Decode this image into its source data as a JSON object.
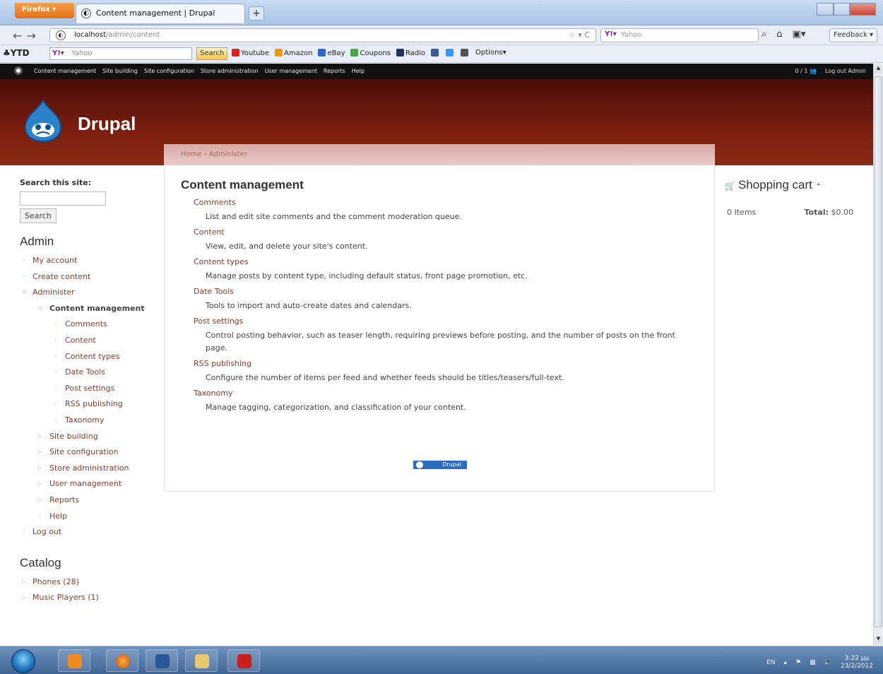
{
  "browser": {
    "button_label": "Firefox",
    "tab_title": "Content management | Drupal",
    "url_host": "localhost",
    "url_path": "/admin/content",
    "search_engine": "Yahoo",
    "feedback_label": "Feedback"
  },
  "toolbar": {
    "brand": "YTD",
    "search_placeholder": "Yahoo",
    "search_button": "Search",
    "links": [
      "Youtube",
      "Amazon",
      "eBay",
      "Coupons",
      "Radio",
      "Options"
    ]
  },
  "admin_menu": {
    "items": [
      "Content management",
      "Site building",
      "Site configuration",
      "Store administration",
      "User management",
      "Reports",
      "Help"
    ],
    "users_count": "0 / 1",
    "logout": "Log out Admin"
  },
  "site": {
    "name": "Drupal",
    "breadcrumb": "Home › Administer"
  },
  "search_block": {
    "title": "Search this site:",
    "button": "Search"
  },
  "admin_block": {
    "title": "Admin",
    "items": [
      "My account",
      "Create content",
      "Administer",
      "Content management",
      "Comments",
      "Content",
      "Content types",
      "Date Tools",
      "Post settings",
      "RSS publishing",
      "Taxonomy",
      "Site building",
      "Site configuration",
      "Store administration",
      "User management",
      "Reports",
      "Help",
      "Log out"
    ]
  },
  "catalog": {
    "title": "Catalog",
    "items": [
      "Phones (28)",
      "Music Players (1)"
    ]
  },
  "main": {
    "title": "Content management",
    "entries": [
      {
        "title": "Comments",
        "desc": "List and edit site comments and the comment moderation queue."
      },
      {
        "title": "Content",
        "desc": "View, edit, and delete your site's content."
      },
      {
        "title": "Content types",
        "desc": "Manage posts by content type, including default status, front page promotion, etc."
      },
      {
        "title": "Date Tools",
        "desc": "Tools to import and auto-create dates and calendars."
      },
      {
        "title": "Post settings",
        "desc": "Control posting behavior, such as teaser length, requiring previews before posting, and the number of posts on the front page."
      },
      {
        "title": "RSS publishing",
        "desc": "Configure the number of items per feed and whether feeds should be titles/teasers/full-text."
      },
      {
        "title": "Taxonomy",
        "desc": "Manage tagging, categorization, and classification of your content."
      }
    ],
    "powered_by": "Drupal"
  },
  "cart": {
    "title": "Shopping cart",
    "items": "0 Items",
    "total_label": "Total:",
    "total_value": "$0.00"
  },
  "taskbar": {
    "lang": "EN",
    "time": "3:22 μμ",
    "date": "23/2/2012"
  }
}
